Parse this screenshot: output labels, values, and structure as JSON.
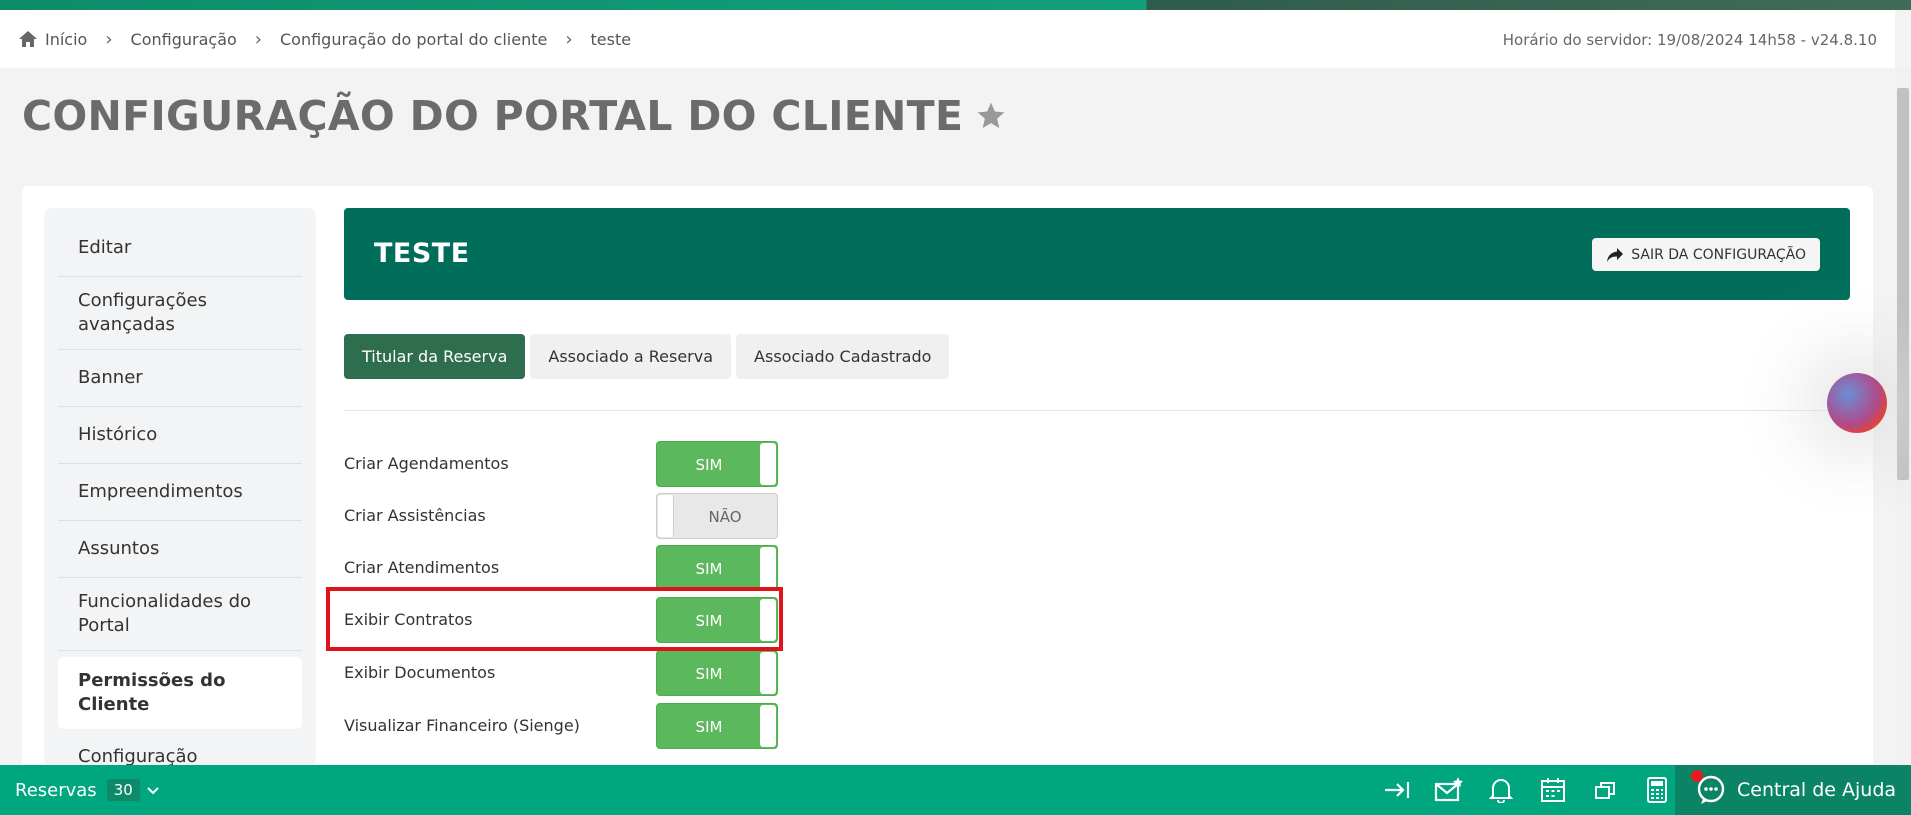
{
  "breadcrumb": {
    "items": [
      "Início",
      "Configuração",
      "Configuração do portal do cliente",
      "teste"
    ]
  },
  "server_time": "Horário do servidor: 19/08/2024 14h58 - v24.8.10",
  "page": {
    "title": "CONFIGURAÇÃO DO PORTAL DO CLIENTE"
  },
  "sidebar": {
    "items": [
      {
        "label": "Editar"
      },
      {
        "label": "Configurações avançadas"
      },
      {
        "label": "Banner"
      },
      {
        "label": "Histórico"
      },
      {
        "label": "Empreendimentos"
      },
      {
        "label": "Assuntos"
      },
      {
        "label": "Funcionalidades do Portal"
      },
      {
        "label": "Permissões do Cliente"
      },
      {
        "label": "Configuração"
      }
    ],
    "active": "Permissões do Cliente"
  },
  "banner": {
    "title": "TESTE",
    "exit_button": "SAIR DA CONFIGURAÇÃO"
  },
  "tabs": [
    {
      "label": "Titular da Reserva",
      "active": true
    },
    {
      "label": "Associado a Reserva",
      "active": false
    },
    {
      "label": "Associado Cadastrado",
      "active": false
    }
  ],
  "permissions": [
    {
      "label": "Criar Agendamentos",
      "value": "SIM",
      "on": true
    },
    {
      "label": "Criar Assistências",
      "value": "NÃO",
      "on": false
    },
    {
      "label": "Criar Atendimentos",
      "value": "SIM",
      "on": true
    },
    {
      "label": "Exibir Contratos",
      "value": "SIM",
      "on": true
    },
    {
      "label": "Exibir Documentos",
      "value": "SIM",
      "on": true
    },
    {
      "label": "Visualizar Financeiro (Sienge)",
      "value": "SIM",
      "on": true
    }
  ],
  "footer": {
    "reservas_label": "Reservas",
    "reservas_count": "30",
    "help_label": "Central de Ajuda"
  },
  "colors": {
    "brand": "#006d5b",
    "footer": "#00a67e",
    "toggle_on": "#5cb85c",
    "highlight": "#e0131a"
  }
}
